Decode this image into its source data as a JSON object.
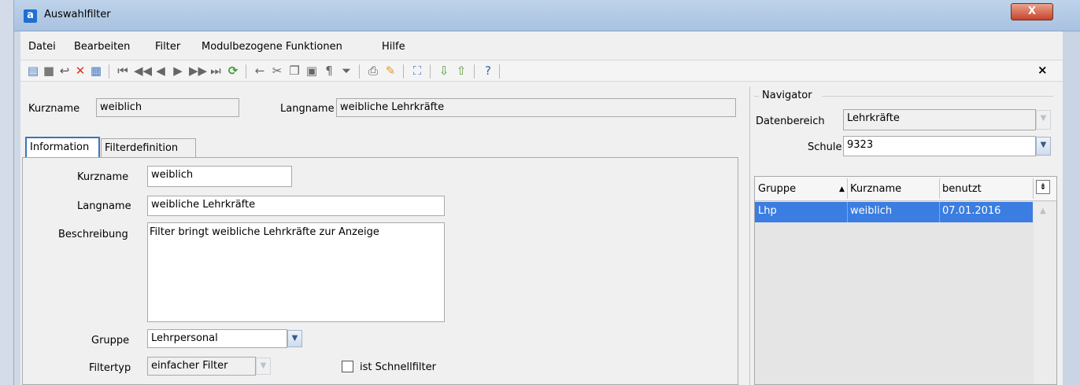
{
  "window": {
    "title": "Auswahlfilter",
    "app_icon": "a",
    "close_glyph": "X"
  },
  "menu": [
    "Datei",
    "Bearbeiten",
    "Filter",
    "Modulbezogene Funktionen",
    "Hilfe"
  ],
  "panel_close": "×",
  "header": {
    "kurzname_label": "Kurzname",
    "kurzname_value": "weiblich",
    "langname_label": "Langname",
    "langname_value": "weibliche Lehrkräfte"
  },
  "tabs": [
    {
      "label": "Information"
    },
    {
      "label": "Filterdefinition"
    }
  ],
  "info": {
    "kurzname_label": "Kurzname",
    "kurzname_value": "weiblich",
    "langname_label": "Langname",
    "langname_value": "weibliche Lehrkräfte",
    "beschreibung_label": "Beschreibung",
    "beschreibung_value": "Filter bringt weibliche Lehrkräfte zur Anzeige",
    "gruppe_label": "Gruppe",
    "gruppe_value": "Lehrpersonal",
    "filtertyp_label": "Filtertyp",
    "filtertyp_value": "einfacher Filter",
    "schnellfilter_label": "ist Schnellfilter",
    "schnellfilter_checked": false
  },
  "navigator": {
    "title": "Navigator",
    "datenbereich_label": "Datenbereich",
    "datenbereich_value": "Lehrkräfte",
    "schule_label": "Schule",
    "schule_value": "9323",
    "columns": [
      "Gruppe",
      "Kurzname",
      "benutzt"
    ],
    "rows": [
      {
        "gruppe": "Lhp",
        "kurzname": "weiblich",
        "benutzt": "07.01.2016"
      }
    ]
  },
  "icons": {
    "toolbar": [
      "new-icon",
      "save-icon",
      "undo-icon",
      "delete-icon",
      "properties-icon",
      "first-icon",
      "prev-page-icon",
      "prev-icon",
      "next-icon",
      "next-page-icon",
      "last-icon",
      "refresh-icon",
      "back-icon",
      "cut-icon",
      "copy-icon",
      "paste-icon",
      "format-icon",
      "filter-icon",
      "print-icon",
      "clear-icon",
      "select-icon",
      "import-icon",
      "export-icon",
      "help-icon"
    ]
  },
  "colors": {
    "selection": "#3b7de0",
    "accent": "#3a73c1"
  }
}
